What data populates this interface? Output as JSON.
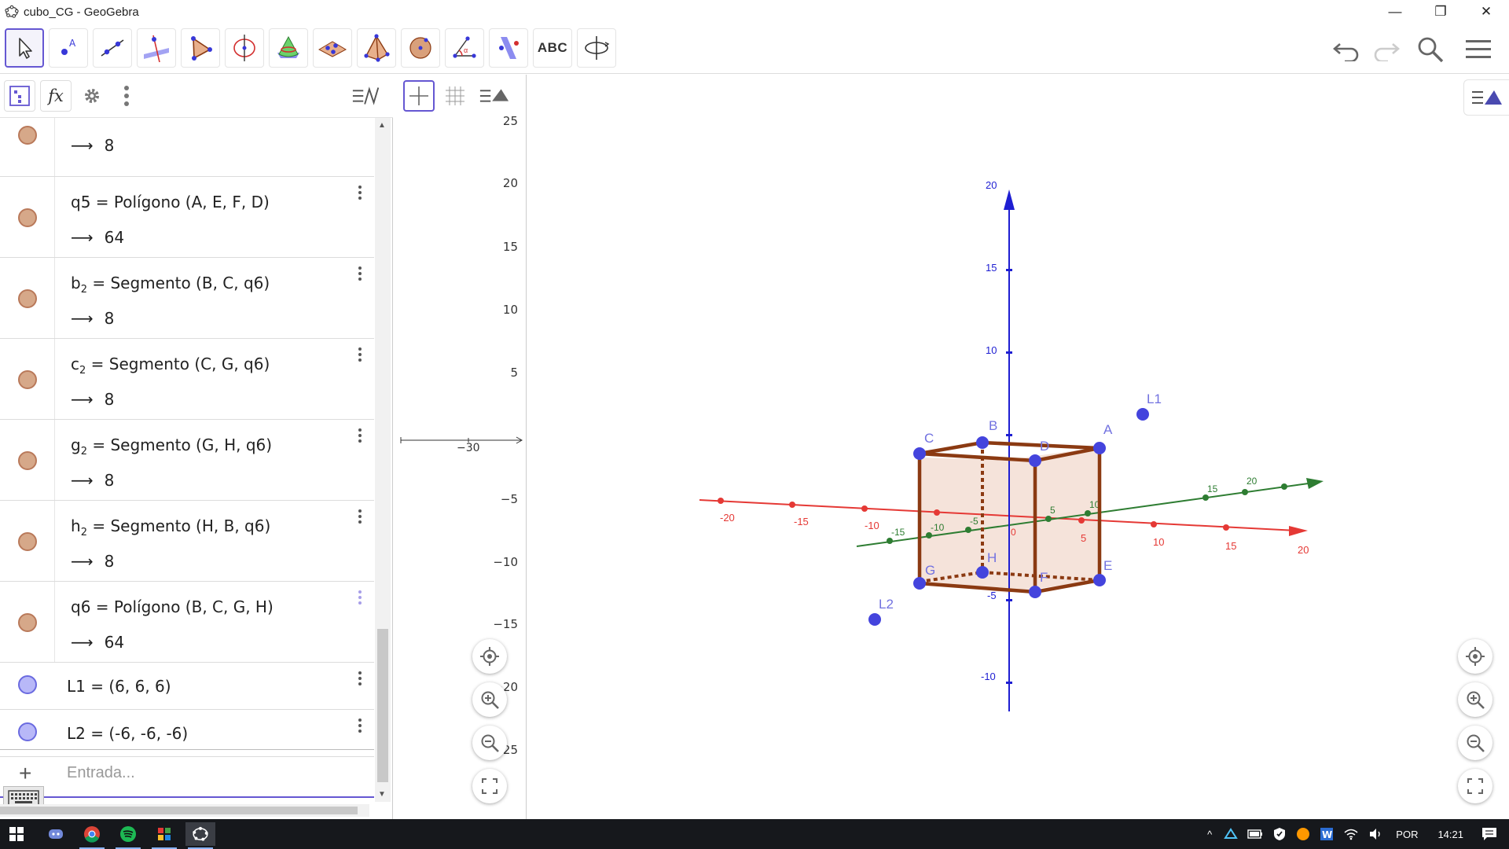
{
  "window": {
    "title": "cubo_CG - GeoGebra",
    "controls": {
      "minimize": "—",
      "restore": "❐",
      "close": "✕"
    }
  },
  "toolbar": {
    "tools": [
      {
        "name": "move-tool"
      },
      {
        "name": "point-tool"
      },
      {
        "name": "line-tool"
      },
      {
        "name": "perpendicular-line-tool"
      },
      {
        "name": "polygon-tool"
      },
      {
        "name": "circle-axis-tool"
      },
      {
        "name": "intersect-surfaces-tool"
      },
      {
        "name": "plane-tool"
      },
      {
        "name": "pyramid-tool"
      },
      {
        "name": "sphere-tool"
      },
      {
        "name": "angle-tool"
      },
      {
        "name": "reflect-tool"
      },
      {
        "name": "text-tool",
        "label": "ABC"
      },
      {
        "name": "rotate-view-tool"
      }
    ]
  },
  "algebra": {
    "rows": [
      {
        "expr_prefix": "",
        "expr_main": "",
        "value": "8",
        "color": "brown"
      },
      {
        "expr_prefix": "q5",
        "sub": "",
        "expr_main": " = Polígono (A, E, F, D)",
        "value": "64",
        "color": "brown"
      },
      {
        "expr_prefix": "b",
        "sub": "2",
        "expr_main": " = Segmento (B, C, q6)",
        "value": "8",
        "color": "brown"
      },
      {
        "expr_prefix": "c",
        "sub": "2",
        "expr_main": " = Segmento (C, G, q6)",
        "value": "8",
        "color": "brown"
      },
      {
        "expr_prefix": "g",
        "sub": "2",
        "expr_main": " = Segmento (G, H, q6)",
        "value": "8",
        "color": "brown"
      },
      {
        "expr_prefix": "h",
        "sub": "2",
        "expr_main": " = Segmento (H, B, q6)",
        "value": "8",
        "color": "brown"
      },
      {
        "expr_prefix": "q6",
        "sub": "",
        "expr_main": " = Polígono (B, C, G, H)",
        "value": "64",
        "color": "brown"
      },
      {
        "expr_prefix": "L1",
        "sub": "",
        "expr_main": " = (6, 6, 6)",
        "value": "",
        "color": "blue"
      },
      {
        "expr_prefix": "L2",
        "sub": "",
        "expr_main": " = (-6, -6, -6)",
        "value": "",
        "color": "blue"
      }
    ],
    "arrow": "⟶",
    "input_placeholder": "Entrada...",
    "plus": "+"
  },
  "graphics2d": {
    "y_ticks": [
      "25",
      "20",
      "15",
      "10",
      "5",
      "−5",
      "−10",
      "−15",
      "−20",
      "−25"
    ],
    "x_tick": "−30"
  },
  "graphics3d": {
    "axis_labels_z": [
      "20",
      "15",
      "10",
      "-5",
      "-10"
    ],
    "axis_labels_x": [
      "-20",
      "-15",
      "-10",
      "5",
      "10",
      "15",
      "20"
    ],
    "axis_labels_y": [
      "-15",
      "-10",
      "-5",
      "5",
      "10",
      "15",
      "20"
    ],
    "origin": "0",
    "points": {
      "A": "A",
      "B": "B",
      "C": "C",
      "D": "D",
      "E": "E",
      "F": "F",
      "G": "G",
      "H": "H",
      "L1": "L1",
      "L2": "L2"
    },
    "colors": {
      "x_axis": "#e53935",
      "y_axis": "#2e7d32",
      "z_axis": "#1e1ed2",
      "cube": "#8b3a12",
      "point": "#4444dd"
    }
  },
  "taskbar": {
    "language": "POR",
    "time": "14:21"
  }
}
